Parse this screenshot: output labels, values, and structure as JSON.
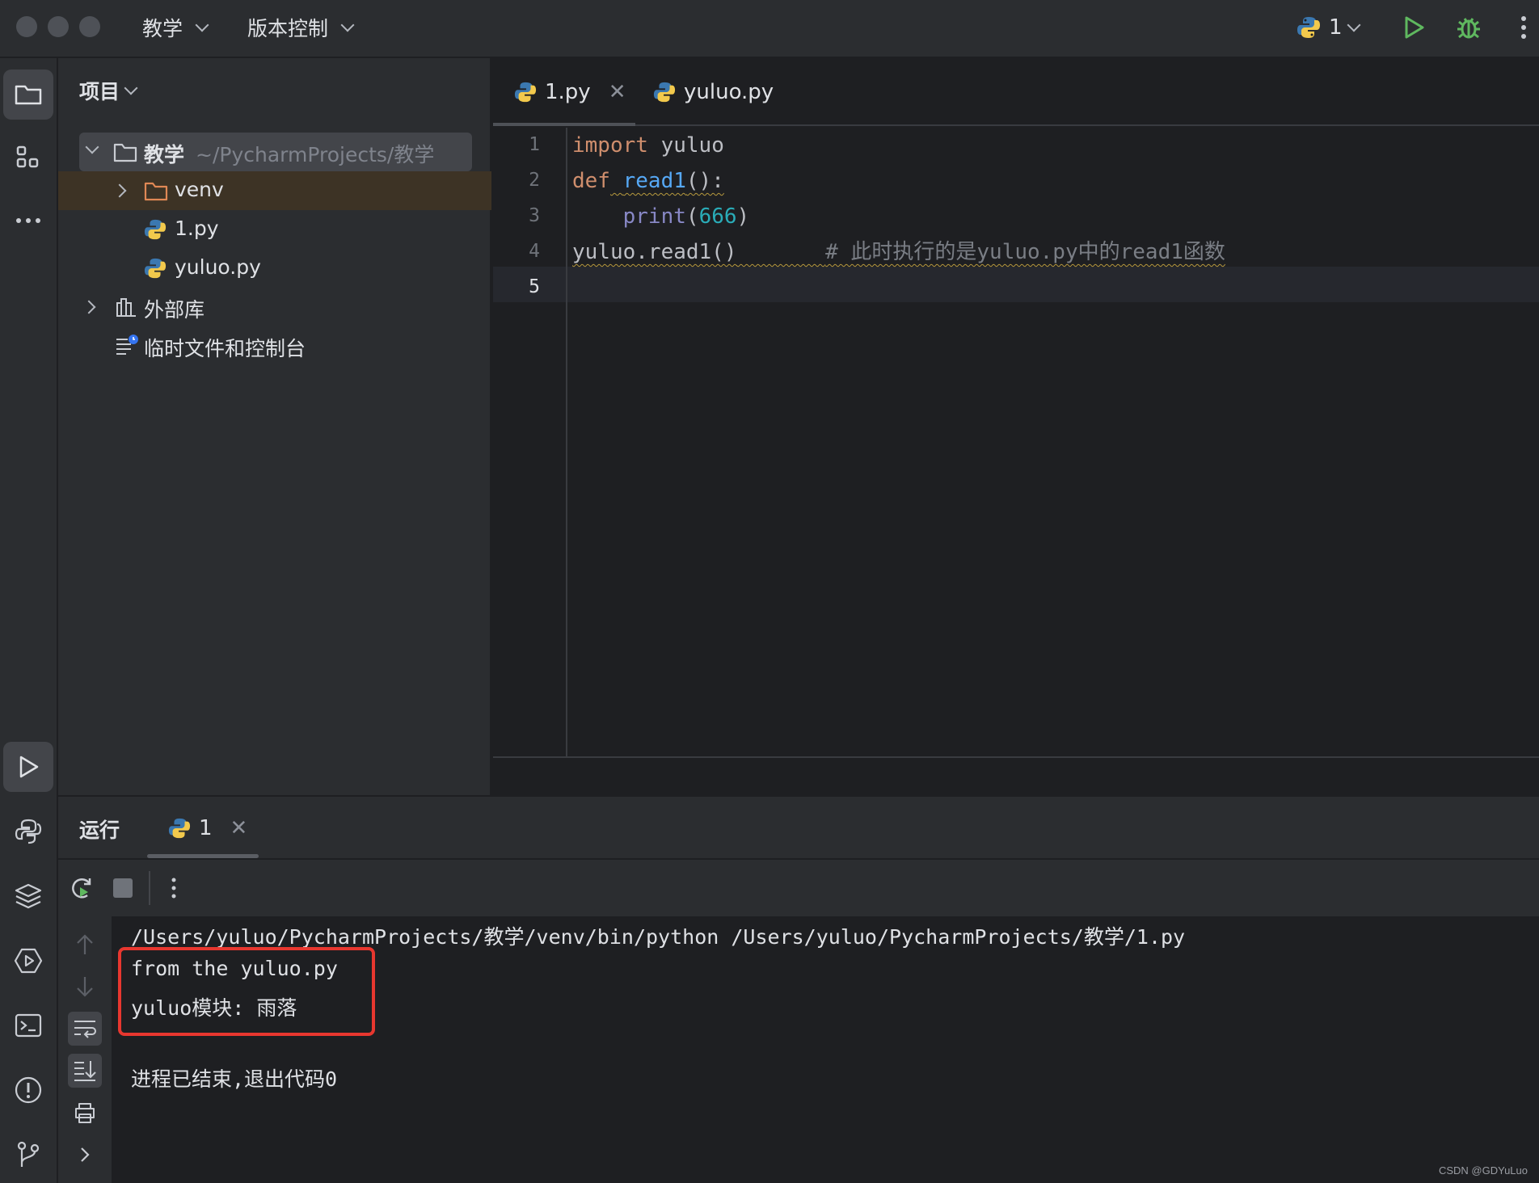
{
  "titlebar": {
    "project_menu": "教学",
    "vcs_menu": "版本控制",
    "run_config": "1"
  },
  "project_panel": {
    "title": "项目",
    "root_name": "教学",
    "root_path": "~/PycharmProjects/教学",
    "items": [
      {
        "label": "venv"
      },
      {
        "label": "1.py"
      },
      {
        "label": "yuluo.py"
      },
      {
        "label": "外部库"
      },
      {
        "label": "临时文件和控制台"
      }
    ]
  },
  "editor": {
    "tabs": [
      {
        "label": "1.py",
        "active": true
      },
      {
        "label": "yuluo.py",
        "active": false
      }
    ],
    "line_numbers": [
      "1",
      "2",
      "3",
      "4",
      "5"
    ],
    "code": {
      "l1_kw": "import",
      "l1_rest": " yuluo",
      "l2_kw": "def",
      "l2_fn": "read1",
      "l2_rest": "():",
      "l3_indent": "    ",
      "l3_builtin": "print",
      "l3_open": "(",
      "l3_num": "666",
      "l3_close": ")",
      "l4_code": "yuluo.read1()",
      "l4_spaces": "       ",
      "l4_comment": "# 此时执行的是yuluo.py中的read1函数"
    }
  },
  "run_panel": {
    "title": "运行",
    "tab_label": "1",
    "console": {
      "command": "/Users/yuluo/PycharmProjects/教学/venv/bin/python /Users/yuluo/PycharmProjects/教学/1.py",
      "out1": "from the yuluo.py",
      "out2": "yuluo模块: 雨落",
      "exit": "进程已结束,退出代码0"
    }
  },
  "watermark": "CSDN @GDYuLuo",
  "colors": {
    "background": "#1e1f22",
    "panel": "#2b2d30",
    "keyword": "#cf8e6d",
    "function": "#56a8f5",
    "number": "#2aacb8",
    "run_green": "#5fb85f",
    "highlight_box": "#e8372f"
  }
}
